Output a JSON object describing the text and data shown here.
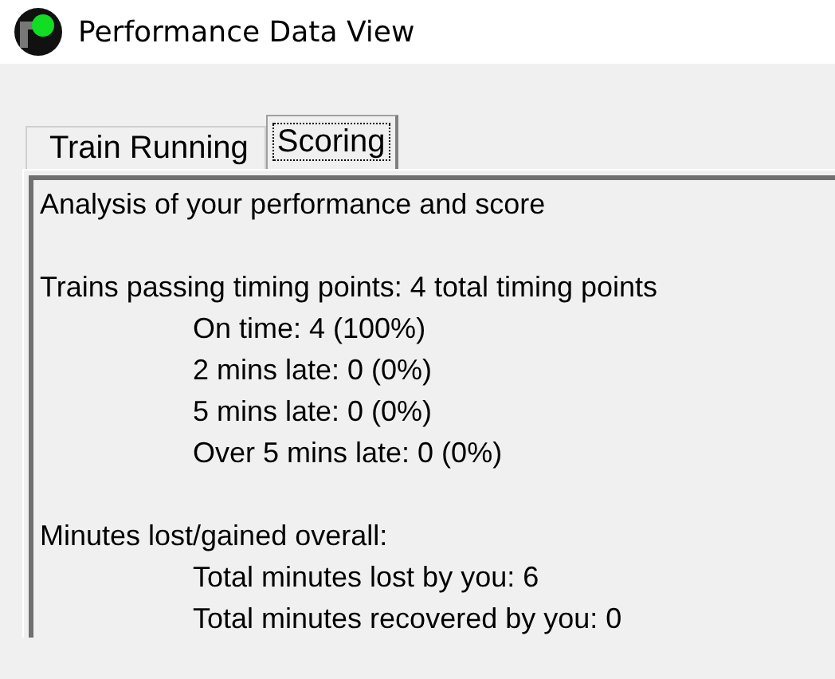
{
  "window": {
    "title": "Performance Data View"
  },
  "tabs": [
    {
      "label": "Train Running",
      "selected": false
    },
    {
      "label": "Scoring",
      "selected": true
    }
  ],
  "report": {
    "intro": "Analysis of your performance and score",
    "sections": [
      {
        "heading": "Trains passing timing points: 4 total timing points",
        "items": [
          "On time: 4 (100%)",
          "2 mins late: 0 (0%)",
          "5 mins late: 0 (0%)",
          "Over 5 mins late: 0 (0%)"
        ]
      },
      {
        "heading": "Minutes lost/gained overall:",
        "items": [
          "Total minutes lost by you: 6",
          "Total minutes recovered by you: 0"
        ]
      }
    ]
  }
}
